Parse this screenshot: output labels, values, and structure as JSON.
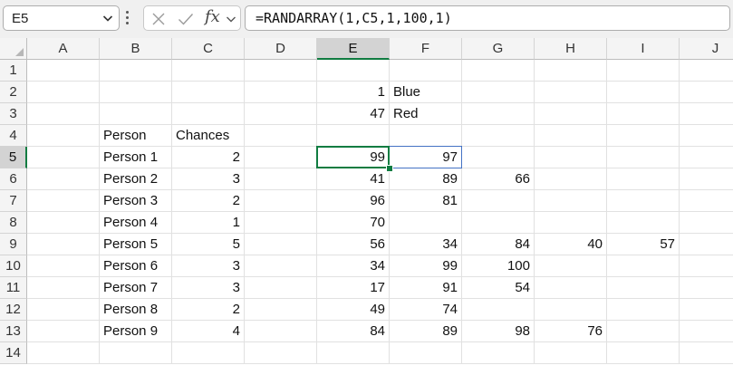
{
  "formula_bar": {
    "name_box": "E5",
    "formula": "=RANDARRAY(1,C5,1,100,1)",
    "fx_label": "fx"
  },
  "columns": [
    "A",
    "B",
    "C",
    "D",
    "E",
    "F",
    "G",
    "H",
    "I",
    "J"
  ],
  "rows": [
    "1",
    "2",
    "3",
    "4",
    "5",
    "6",
    "7",
    "8",
    "9",
    "10",
    "11",
    "12",
    "13",
    "14"
  ],
  "selected": {
    "column": "E",
    "row": "5"
  },
  "cells": [
    {
      "ref": "E2",
      "value": "1",
      "type": "num"
    },
    {
      "ref": "F2",
      "value": "Blue",
      "type": "text"
    },
    {
      "ref": "E3",
      "value": "47",
      "type": "num"
    },
    {
      "ref": "F3",
      "value": "Red",
      "type": "text"
    },
    {
      "ref": "B4",
      "value": "Person",
      "type": "text"
    },
    {
      "ref": "C4",
      "value": "Chances",
      "type": "text"
    },
    {
      "ref": "B5",
      "value": "Person 1",
      "type": "text"
    },
    {
      "ref": "C5",
      "value": "2",
      "type": "num"
    },
    {
      "ref": "E5",
      "value": "99",
      "type": "num"
    },
    {
      "ref": "F5",
      "value": "97",
      "type": "num"
    },
    {
      "ref": "B6",
      "value": "Person 2",
      "type": "text"
    },
    {
      "ref": "C6",
      "value": "3",
      "type": "num"
    },
    {
      "ref": "E6",
      "value": "41",
      "type": "num"
    },
    {
      "ref": "F6",
      "value": "89",
      "type": "num"
    },
    {
      "ref": "G6",
      "value": "66",
      "type": "num"
    },
    {
      "ref": "B7",
      "value": "Person 3",
      "type": "text"
    },
    {
      "ref": "C7",
      "value": "2",
      "type": "num"
    },
    {
      "ref": "E7",
      "value": "96",
      "type": "num"
    },
    {
      "ref": "F7",
      "value": "81",
      "type": "num"
    },
    {
      "ref": "B8",
      "value": "Person 4",
      "type": "text"
    },
    {
      "ref": "C8",
      "value": "1",
      "type": "num"
    },
    {
      "ref": "E8",
      "value": "70",
      "type": "num"
    },
    {
      "ref": "B9",
      "value": "Person 5",
      "type": "text"
    },
    {
      "ref": "C9",
      "value": "5",
      "type": "num"
    },
    {
      "ref": "E9",
      "value": "56",
      "type": "num"
    },
    {
      "ref": "F9",
      "value": "34",
      "type": "num"
    },
    {
      "ref": "G9",
      "value": "84",
      "type": "num"
    },
    {
      "ref": "H9",
      "value": "40",
      "type": "num"
    },
    {
      "ref": "I9",
      "value": "57",
      "type": "num"
    },
    {
      "ref": "B10",
      "value": "Person 6",
      "type": "text"
    },
    {
      "ref": "C10",
      "value": "3",
      "type": "num"
    },
    {
      "ref": "E10",
      "value": "34",
      "type": "num"
    },
    {
      "ref": "F10",
      "value": "99",
      "type": "num"
    },
    {
      "ref": "G10",
      "value": "100",
      "type": "num"
    },
    {
      "ref": "B11",
      "value": "Person 7",
      "type": "text"
    },
    {
      "ref": "C11",
      "value": "3",
      "type": "num"
    },
    {
      "ref": "E11",
      "value": "17",
      "type": "num"
    },
    {
      "ref": "F11",
      "value": "91",
      "type": "num"
    },
    {
      "ref": "G11",
      "value": "54",
      "type": "num"
    },
    {
      "ref": "B12",
      "value": "Person 8",
      "type": "text"
    },
    {
      "ref": "C12",
      "value": "2",
      "type": "num"
    },
    {
      "ref": "E12",
      "value": "49",
      "type": "num"
    },
    {
      "ref": "F12",
      "value": "74",
      "type": "num"
    },
    {
      "ref": "B13",
      "value": "Person 9",
      "type": "text"
    },
    {
      "ref": "C13",
      "value": "4",
      "type": "num"
    },
    {
      "ref": "E13",
      "value": "84",
      "type": "num"
    },
    {
      "ref": "F13",
      "value": "89",
      "type": "num"
    },
    {
      "ref": "G13",
      "value": "98",
      "type": "num"
    },
    {
      "ref": "H13",
      "value": "76",
      "type": "num"
    }
  ],
  "colors": {
    "accent": "#107c41",
    "spill_border": "#4472c4"
  }
}
